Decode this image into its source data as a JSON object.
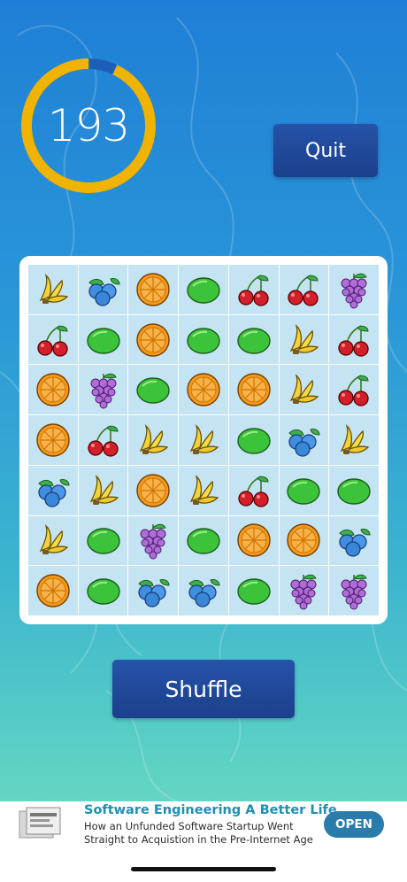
{
  "timer": {
    "value": "193",
    "progress": 0.93,
    "track_color": "#1d5fb8",
    "fill_color": "#f0b400"
  },
  "buttons": {
    "quit_label": "Quit",
    "shuffle_label": "Shuffle"
  },
  "board": {
    "rows": [
      [
        "banana",
        "blueberry",
        "orange",
        "lime",
        "cherry",
        "cherry",
        "grape"
      ],
      [
        "cherry",
        "lime",
        "orange",
        "lime",
        "lime",
        "banana",
        "cherry"
      ],
      [
        "orange",
        "grape",
        "lime",
        "orange",
        "orange",
        "banana",
        "cherry"
      ],
      [
        "orange",
        "cherry",
        "banana",
        "banana",
        "lime",
        "blueberry",
        "banana"
      ],
      [
        "blueberry",
        "banana",
        "orange",
        "banana",
        "cherry",
        "lime",
        "lime"
      ],
      [
        "banana",
        "lime",
        "grape",
        "lime",
        "orange",
        "orange",
        "blueberry"
      ],
      [
        "orange",
        "lime",
        "blueberry",
        "blueberry",
        "lime",
        "grape",
        "grape"
      ]
    ]
  },
  "ad": {
    "title": "Software Engineering A Better Life",
    "body": "How an Unfunded Software Startup Went Straight to Acquistion in the Pre-Internet Age",
    "cta": "OPEN",
    "thumbnail_icon": "book-cover-icon"
  }
}
